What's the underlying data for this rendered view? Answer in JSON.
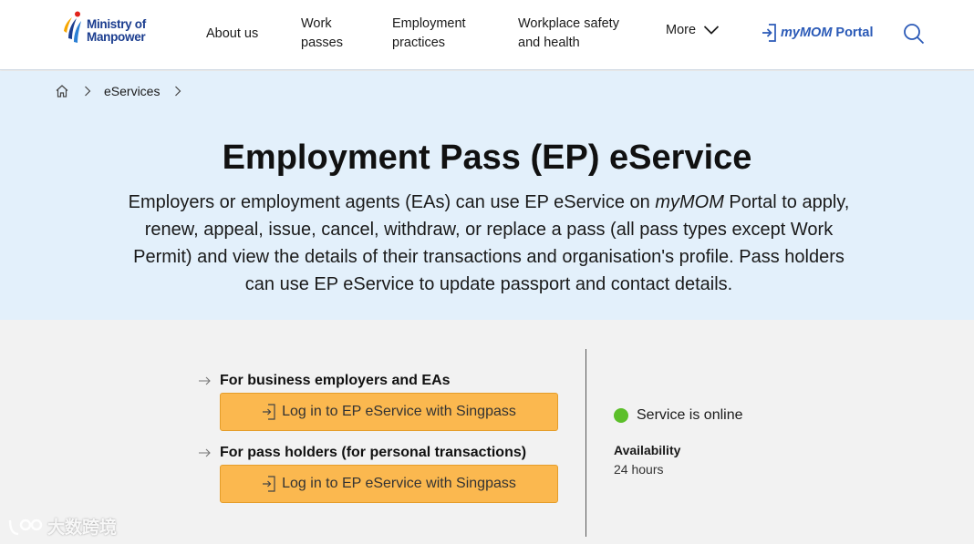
{
  "header": {
    "logo_line1": "Ministry of",
    "logo_line2": "Manpower",
    "nav": {
      "about": "About us",
      "work_passes_1": "Work",
      "work_passes_2": "passes",
      "employment_1": "Employment",
      "employment_2": "practices",
      "safety_1": "Workplace safety",
      "safety_2": "and health",
      "more": "More"
    },
    "portal_brand": "myMOM",
    "portal_rest": "Portal"
  },
  "breadcrumb": {
    "item": "eServices"
  },
  "hero": {
    "title": "Employment Pass (EP) eService",
    "desc_part1": "Employers or employment agents (EAs) can use EP eService on ",
    "desc_brand": "myMOM",
    "desc_part2": " Portal to apply, renew, appeal, issue, cancel, withdraw, or replace a pass (all pass types except Work Permit) and view the details of their transactions and organisation's profile. Pass holders can use EP eService to update passport and contact details."
  },
  "login": {
    "employers_label": "For business employers and EAs",
    "employers_button": "Log in to EP eService with Singpass",
    "holders_label": "For pass holders (for personal transactions)",
    "holders_button": "Log in to EP eService with Singpass"
  },
  "service": {
    "status": "Service is online",
    "status_color": "#5cbf2a",
    "availability_label": "Availability",
    "availability_value": "24 hours"
  },
  "watermark": "大数跨境",
  "colors": {
    "brand_blue": "#1b3d8f",
    "portal_blue": "#2b5ab7",
    "hero_bg": "#e3f0fb",
    "button_orange": "#fbb84f"
  }
}
